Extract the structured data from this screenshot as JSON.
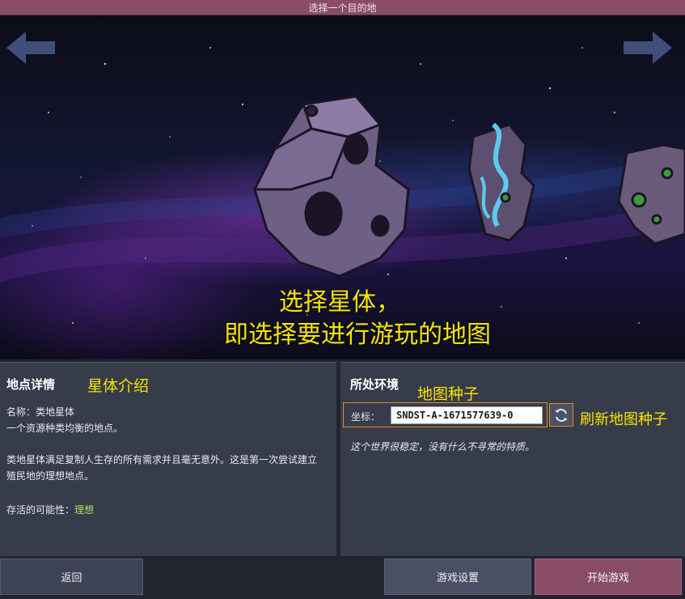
{
  "window": {
    "title": "选择一个目的地"
  },
  "hero": {
    "caption_line1": "选择星体，",
    "caption_line2": "即选择要进行游玩的地图"
  },
  "icons": {
    "prev": "arrow-left-icon",
    "next": "arrow-right-icon",
    "refresh": "refresh-icon"
  },
  "details": {
    "heading": "地点详情",
    "annotation": "星体介绍",
    "name_line": "名称：类地星体",
    "subtitle": "一个资源种类均衡的地点。",
    "description": "类地星体满足复制人生存的所有需求并且毫无意外。这是第一次尝试建立殖民地的理想地点。",
    "survival_label": "存活的可能性：",
    "survival_value": "理想"
  },
  "environment": {
    "heading": "所处环境",
    "seed_annotation": "地图种子",
    "coord_label": "坐标：",
    "coord_value": "SNDST-A-1671577639-0",
    "refresh_annotation": "刷新地图种子",
    "trait_text": "这个世界很稳定，没有什么不寻常的特质。"
  },
  "buttons": {
    "back": "返回",
    "settings": "游戏设置",
    "start": "开始游戏"
  },
  "colors": {
    "accent": "#8a4d68",
    "annotation": "#f5e400",
    "highlight_border": "#e08b1e",
    "survival_green": "#a8e25a"
  }
}
